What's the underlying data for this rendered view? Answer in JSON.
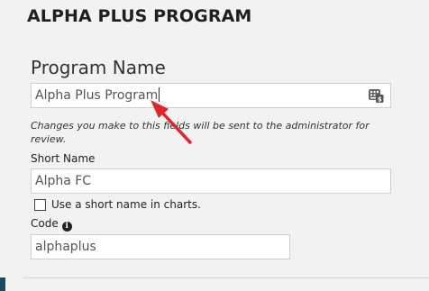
{
  "page": {
    "title": "ALPHA PLUS PROGRAM"
  },
  "program_name": {
    "heading": "Program Name",
    "value": "Alpha Plus Program",
    "translate_icon": "translate-icon",
    "notice": "Changes you make to this fields will be sent to the administrator for review."
  },
  "short_name": {
    "label": "Short Name",
    "value": "Alpha FC",
    "checkbox_label": "Use a short name in charts.",
    "checkbox_checked": false
  },
  "code": {
    "label": "Code",
    "info_icon": "info-icon",
    "info_glyph": "i",
    "value": "alphaplus"
  },
  "annotation": {
    "arrow_color": "#e0262b"
  },
  "colors": {
    "background": "#f2f2f2",
    "side_tab": "#1b4a5c"
  }
}
